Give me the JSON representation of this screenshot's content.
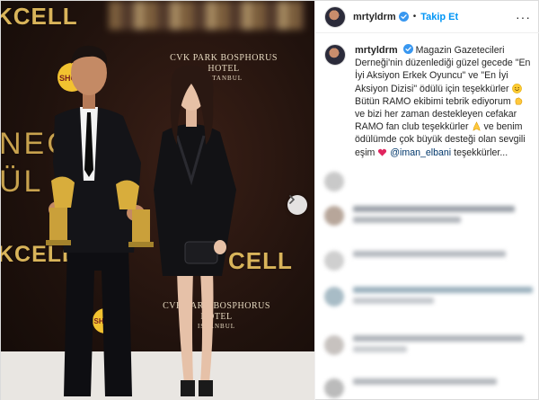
{
  "photo": {
    "backdrop_top": "KCELL",
    "backdrop_big_1": "NEÇ",
    "backdrop_big_2": "ÜL",
    "backdrop_mid": "KCELL",
    "backdrop_right": "CELL",
    "hotel_name_1": "CVK PARK BOSPHORUS HOTEL",
    "hotel_city_1": "ISTANBUL",
    "hotel_name_2": "CVK PARK BOSPHORUS HOTEL",
    "hotel_city_2": "ISTANBUL",
    "show_logo": "SHOW"
  },
  "header": {
    "username": "mrtyldrm",
    "separator": "•",
    "follow_label": "Takip Et",
    "more_label": "···"
  },
  "caption": {
    "username": "mrtyldrm",
    "part1": "Magazin Gazetecileri Derneği'nin düzenlediği güzel gecede \"En İyi Aksiyon Erkek Oyuncu\" ve \"En İyi Aksiyon Dizisi\" ödülü için teşekkürler",
    "part2": "Bütün RAMO ekibimi tebrik ediyorum",
    "part3": "ve bizi her zaman destekleyen cefakar RAMO fan club teşekkürler",
    "part4": "ve benim ödülümde çok büyük desteği olan sevgili eşim",
    "mention": "@iman_elbani",
    "part5": "teşekkürler..."
  },
  "colors": {
    "link_blue": "#0095f6",
    "mention_blue": "#00376b",
    "verified_blue": "#3897f0",
    "backdrop_gold": "#d9b45a"
  },
  "icons": {
    "verified": "verified-badge-icon",
    "carousel_next": "chevron-right-icon",
    "emoji_smile": "smile-emoji-icon",
    "emoji_clap": "clap-emoji-icon",
    "emoji_pray": "pray-emoji-icon",
    "emoji_heart": "heart-emoji-icon"
  }
}
